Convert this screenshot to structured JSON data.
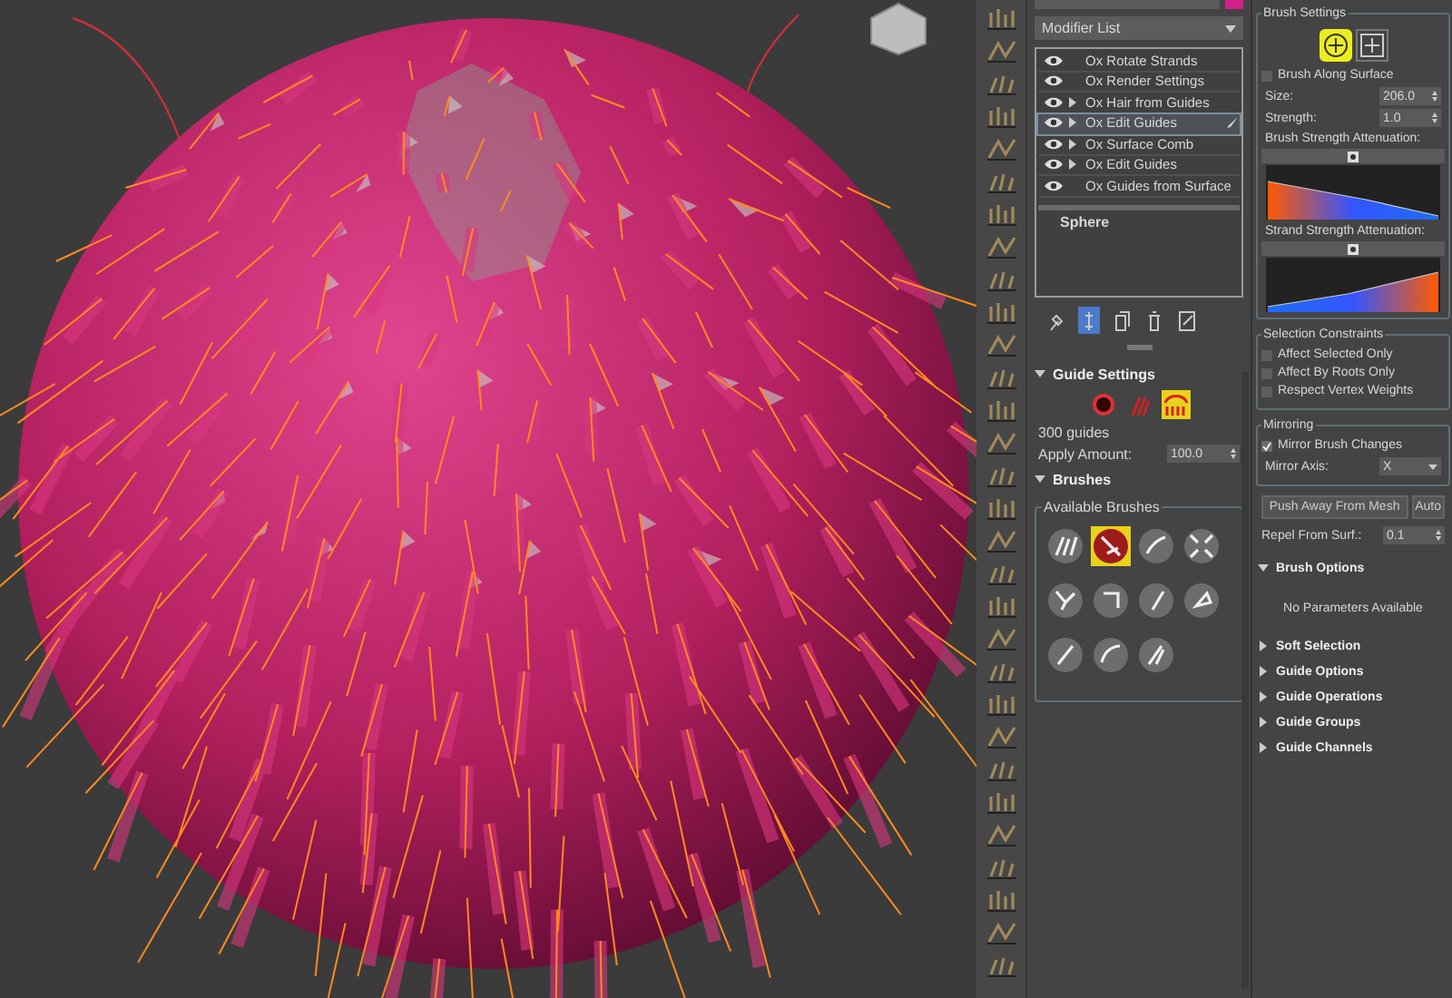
{
  "modifier_list": {
    "label": "Modifier List"
  },
  "modifier_stack": [
    {
      "name": "Ox Rotate Strands",
      "expandable": false,
      "selected": false
    },
    {
      "name": "Ox Render Settings",
      "expandable": false,
      "selected": false
    },
    {
      "name": "Ox Hair from Guides",
      "expandable": true,
      "selected": false
    },
    {
      "name": "Ox Edit Guides",
      "expandable": true,
      "selected": true
    },
    {
      "name": "Ox Surface Comb",
      "expandable": true,
      "selected": false
    },
    {
      "name": "Ox Edit Guides",
      "expandable": true,
      "selected": false
    },
    {
      "name": "Ox Guides from Surface",
      "expandable": false,
      "selected": false
    }
  ],
  "base_object": "Sphere",
  "stack_tools": [
    {
      "selected": false
    },
    {
      "selected": true
    },
    {
      "selected": false
    },
    {
      "selected": false
    },
    {
      "selected": false
    }
  ],
  "guide_settings": {
    "title": "Guide Settings",
    "expanded": true,
    "display_modes": [
      {
        "selected": false
      },
      {
        "selected": false
      },
      {
        "selected": true
      }
    ],
    "guide_count": "300 guides",
    "apply_amount_label": "Apply Amount:",
    "apply_amount": "100.0"
  },
  "brushes": {
    "title": "Brushes",
    "expanded": true,
    "group_label": "Available Brushes",
    "items": [
      {
        "selected": false
      },
      {
        "selected": true
      },
      {
        "selected": false
      },
      {
        "selected": false
      },
      {
        "selected": false
      },
      {
        "selected": false
      },
      {
        "selected": false
      },
      {
        "selected": false
      },
      {
        "selected": false
      },
      {
        "selected": false
      },
      {
        "selected": false
      }
    ]
  },
  "brush_settings": {
    "title": "Brush Settings",
    "modes": [
      {
        "selected": true
      },
      {
        "selected": false
      }
    ],
    "along_surface": {
      "label": "Brush Along Surface",
      "checked": false
    },
    "size_label": "Size:",
    "size": "206.0",
    "strength_label": "Strength:",
    "strength": "1.0",
    "brush_attenuation_label": "Brush Strength Attenuation:",
    "strand_attenuation_label": "Strand Strength Attenuation:"
  },
  "selection_constraints": {
    "title": "Selection Constraints",
    "options": [
      {
        "label": "Affect Selected Only",
        "checked": false
      },
      {
        "label": "Affect By Roots Only",
        "checked": false
      },
      {
        "label": "Respect Vertex Weights",
        "checked": false
      }
    ]
  },
  "mirroring": {
    "title": "Mirroring",
    "mirror": {
      "label": "Mirror Brush Changes",
      "checked": true
    },
    "axis_label": "Mirror Axis:",
    "axis": "X"
  },
  "push_button": "Push Away From Mesh",
  "auto_button": "Auto",
  "repel_label": "Repel From Surf.:",
  "repel": "0.1",
  "brush_options": {
    "title": "Brush Options",
    "expanded": true,
    "message": "No Parameters Available"
  },
  "collapsed_sections": [
    {
      "title": "Soft Selection",
      "expanded": false
    },
    {
      "title": "Guide Options",
      "expanded": false
    },
    {
      "title": "Guide Operations",
      "expanded": false
    },
    {
      "title": "Guide Groups",
      "expanded": false
    },
    {
      "title": "Guide Channels",
      "expanded": false
    }
  ]
}
